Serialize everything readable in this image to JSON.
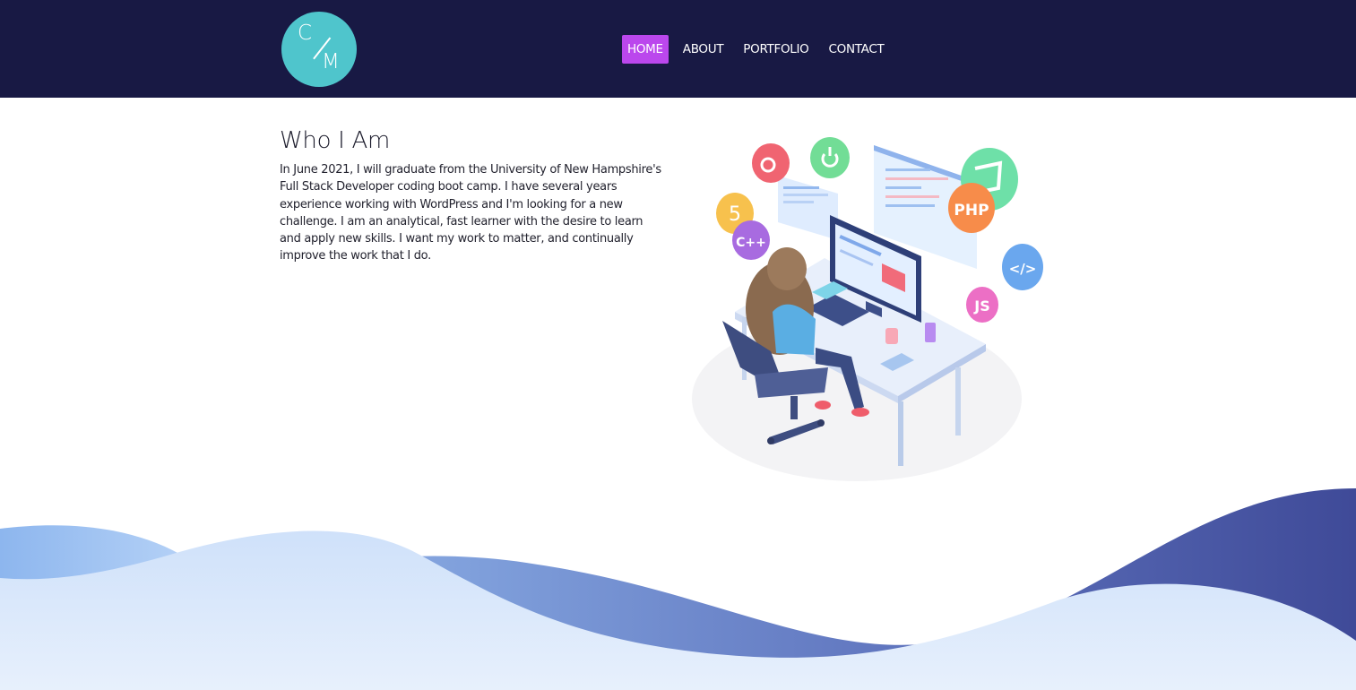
{
  "logo": {
    "letter_top": "C",
    "letter_bottom": "M"
  },
  "nav": {
    "items": [
      {
        "label": "HOME",
        "active": true
      },
      {
        "label": "ABOUT",
        "active": false
      },
      {
        "label": "PORTFOLIO",
        "active": false
      },
      {
        "label": "CONTACT",
        "active": false
      }
    ]
  },
  "main": {
    "title": "Who I Am",
    "body": "In June 2021, I will graduate from the University of New Hampshire's Full Stack Developer coding boot camp. I have several years experience working with WordPress and I'm looking for a new challenge. I am an analytical, fast learner with the desire to learn and apply new skills. I want my work to matter, and continually improve the work that I do."
  },
  "illustration": {
    "badges": [
      {
        "label": "PHP",
        "color": "#f78c4a"
      },
      {
        "label": "</>",
        "color": "#6aa7ee"
      },
      {
        "label": "JS",
        "color": "#ec6fc5"
      },
      {
        "label": "C++",
        "color": "#a86be0"
      },
      {
        "label": "5",
        "color": "#f7c14d"
      }
    ]
  },
  "colors": {
    "header_bg": "#181944",
    "accent": "#bb47ed",
    "logo_bg": "#4fc5cc"
  }
}
